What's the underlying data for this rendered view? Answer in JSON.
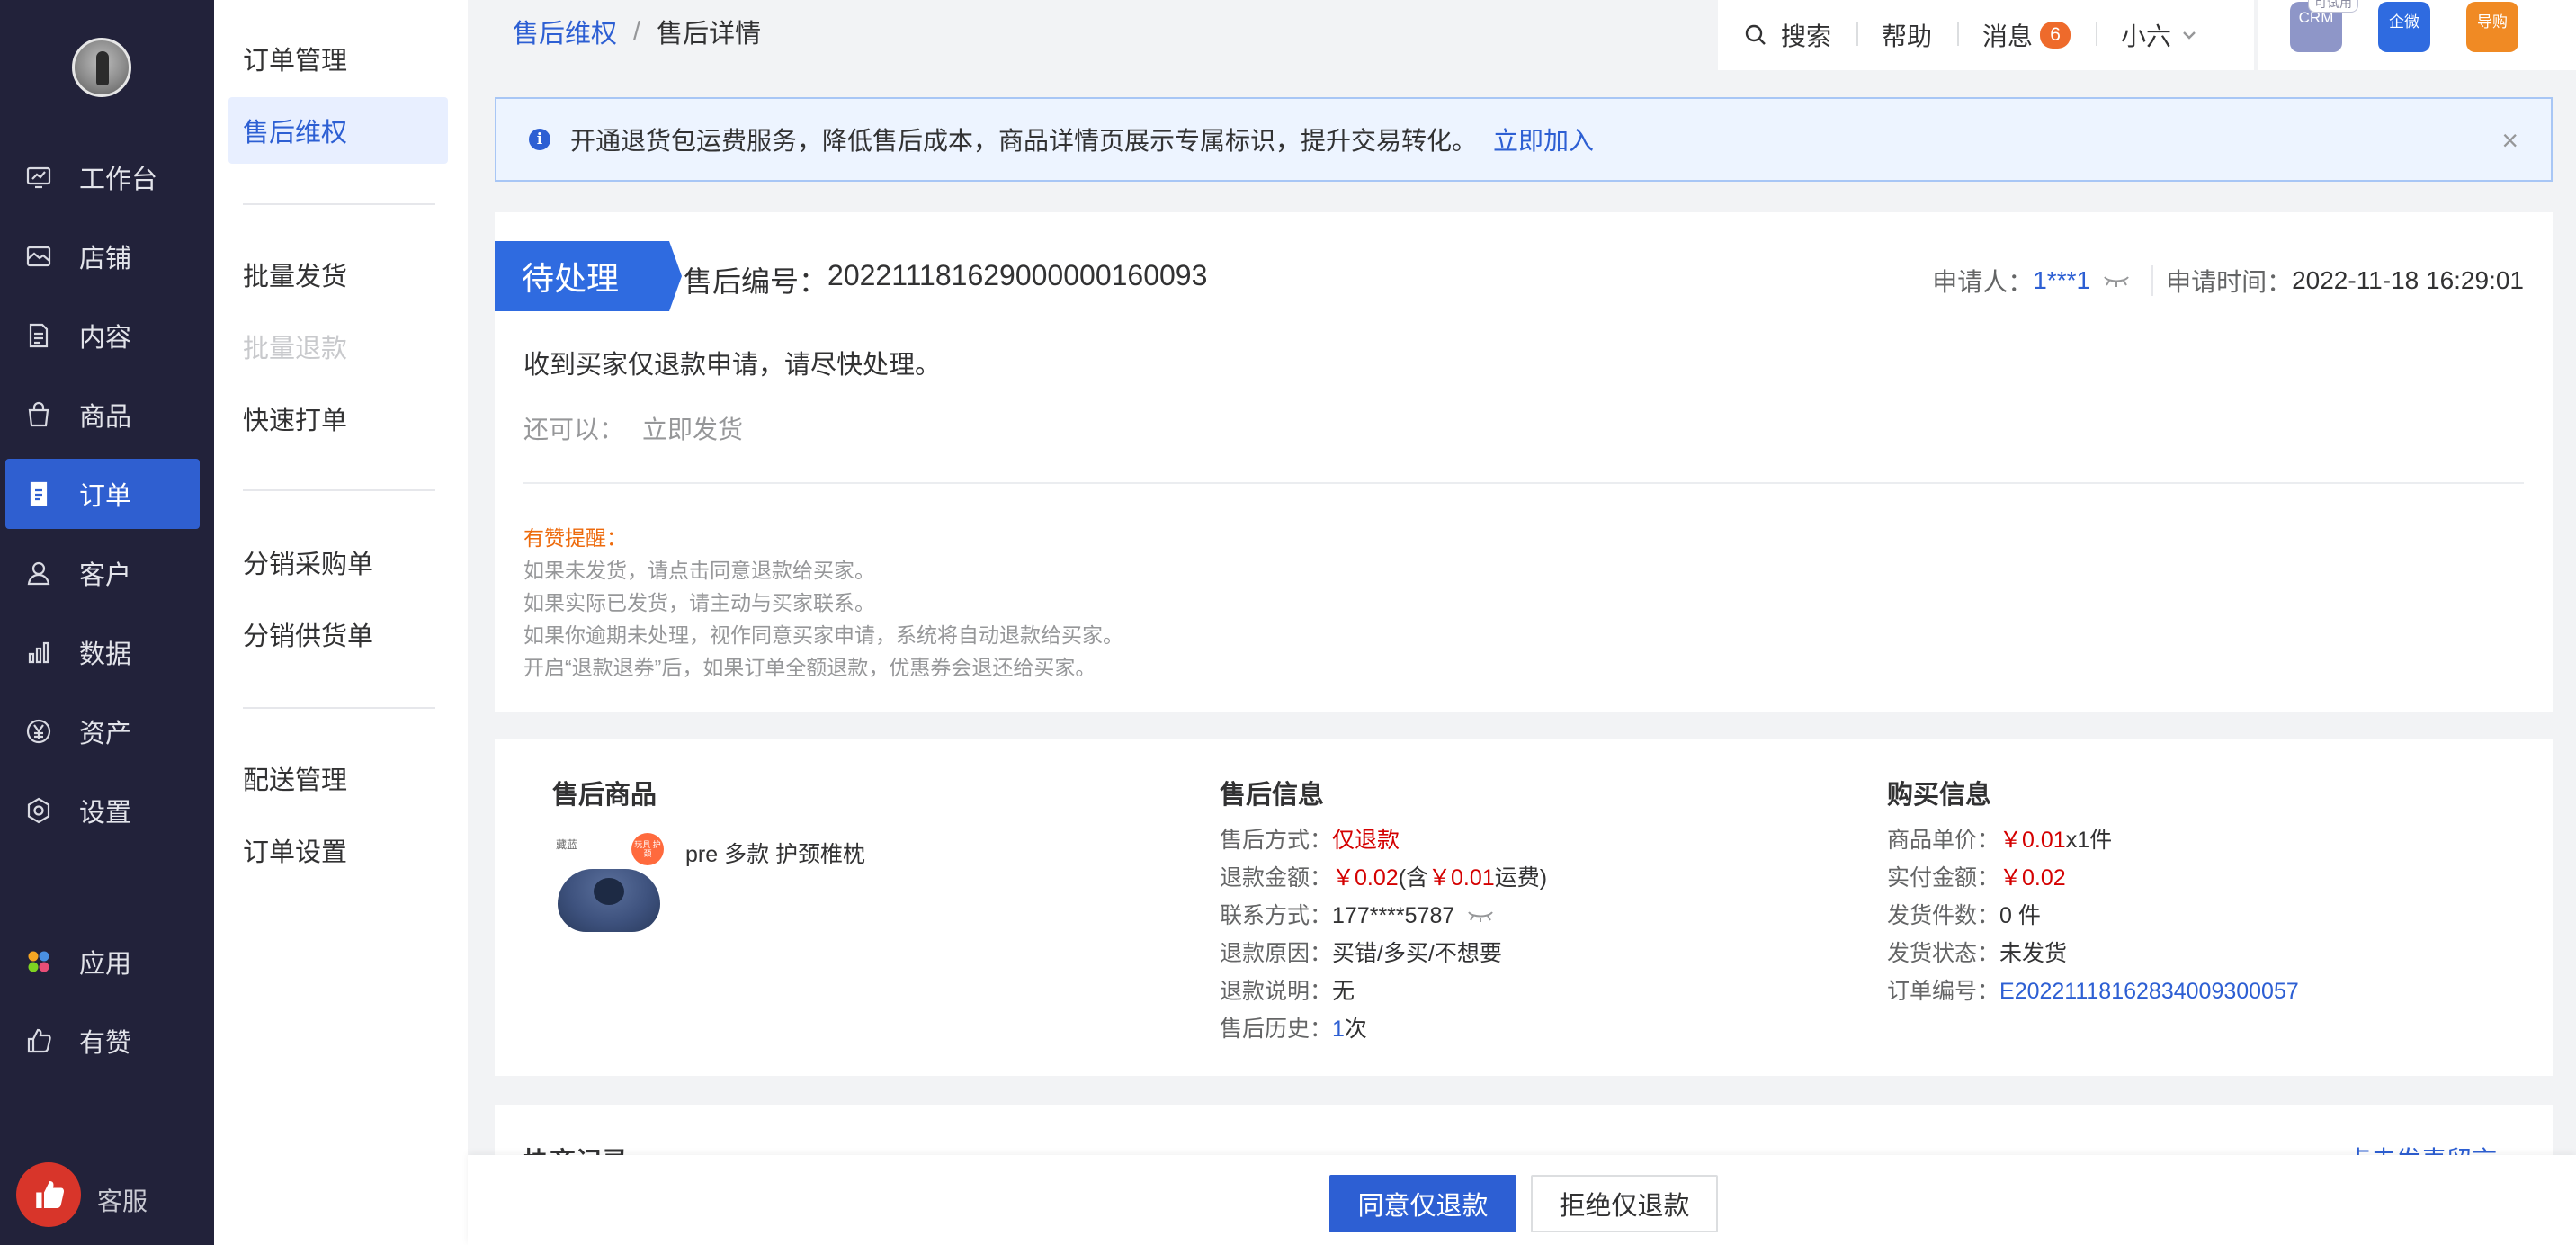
{
  "nav": {
    "items": [
      {
        "label": "工作台",
        "icon": "workbench-icon"
      },
      {
        "label": "店铺",
        "icon": "store-icon"
      },
      {
        "label": "内容",
        "icon": "content-icon"
      },
      {
        "label": "商品",
        "icon": "goods-icon"
      },
      {
        "label": "订单",
        "icon": "order-icon",
        "active": true
      },
      {
        "label": "客户",
        "icon": "customer-icon"
      },
      {
        "label": "数据",
        "icon": "data-icon"
      },
      {
        "label": "资产",
        "icon": "asset-icon"
      },
      {
        "label": "设置",
        "icon": "settings-icon"
      },
      {
        "label": "应用",
        "icon": "apps-icon"
      },
      {
        "label": "有赞",
        "icon": "youzan-icon"
      }
    ],
    "kefu_label": "客服"
  },
  "subnav": {
    "items": [
      {
        "label": "订单管理"
      },
      {
        "label": "售后维权",
        "active": true
      },
      {
        "label": "批量发货"
      },
      {
        "label": "批量退款",
        "disabled": true
      },
      {
        "label": "快速打单"
      },
      {
        "label": "分销采购单"
      },
      {
        "label": "分销供货单"
      },
      {
        "label": "配送管理"
      },
      {
        "label": "订单设置"
      }
    ]
  },
  "breadcrumb": {
    "parent": "售后维权",
    "separator": "/",
    "current": "售后详情"
  },
  "topbar": {
    "search": "搜索",
    "help": "帮助",
    "messages": "消息",
    "message_count": "6",
    "user": "小六"
  },
  "apps": {
    "crm": "CRM",
    "crm_tag": "可试用",
    "qiwei": "企微",
    "daogou": "导购"
  },
  "notice": {
    "text": "开通退货包运费服务，降低售后成本，商品详情页展示专属标识，提升交易转化。",
    "link": "立即加入",
    "close": "×"
  },
  "status": {
    "tag": "待处理",
    "sn_label": "售后编号：",
    "sn": "202211181629000000160093",
    "applicant_label": "申请人：",
    "applicant": "1***1",
    "apply_time_label": "申请时间：",
    "apply_time": "2022-11-18 16:29:01",
    "message": "收到买家仅退款申请，请尽快处理。",
    "also_label": "还可以：",
    "also_action": "立即发货",
    "tips_title": "有赞提醒：",
    "tips": [
      "如果未发货，请点击同意退款给买家。",
      "如果实际已发货，请主动与买家联系。",
      "如果你逾期未处理，视作同意买家申请，系统将自动退款给买家。",
      "开启“退款退券”后，如果订单全额退款，优惠券会退还给买家。"
    ]
  },
  "product": {
    "title": "售后商品",
    "name": "pre 多款 护颈椎枕",
    "image_brand": "藏蓝",
    "image_sticker": "玩具 护颈"
  },
  "aftersale": {
    "title": "售后信息",
    "method_label": "售后方式：",
    "method": "仅退款",
    "amount_label": "退款金额：",
    "amount": "￥0.02",
    "amount_note_prefix": " (含",
    "amount_shipping": "￥0.01",
    "amount_note_suffix": "运费)",
    "contact_label": "联系方式：",
    "contact": "177****5787",
    "reason_label": "退款原因：",
    "reason": "买错/多买/不想要",
    "desc_label": "退款说明：",
    "desc": "无",
    "history_label": "售后历史：",
    "history_count": "1",
    "history_unit": "次"
  },
  "purchase": {
    "title": "购买信息",
    "unit_price_label": "商品单价：",
    "unit_price": "￥0.01",
    "quantity": " x1件",
    "paid_label": "实付金额：",
    "paid": "￥0.02",
    "shipped_count_label": "发货件数：",
    "shipped_count": "0 件",
    "ship_status_label": "发货状态：",
    "ship_status": "未发货",
    "order_no_label": "订单编号：",
    "order_no": "E20221118162834009300057"
  },
  "record": {
    "title": "协商记录",
    "link": "点击发表留言"
  },
  "actions": {
    "agree": "同意仅退款",
    "reject": "拒绝仅退款"
  }
}
